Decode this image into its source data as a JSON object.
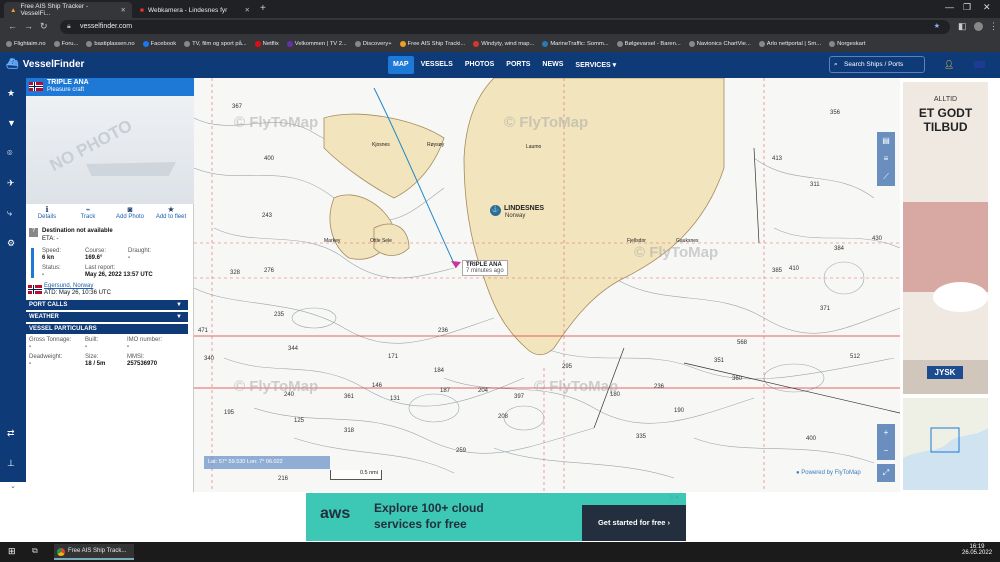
{
  "browser": {
    "tabs": [
      {
        "title": "Free AIS Ship Tracker - VesselFi...",
        "active": true
      },
      {
        "title": "Webkamera - Lindesnes fyr",
        "active": false
      }
    ],
    "url": "vesselfinder.com",
    "bookmarks": [
      "Flightaim.no",
      "Foru...",
      "bastiplassen.no",
      "Facebook",
      "TV, film og sport på...",
      "Netflix",
      "Velkommen | TV 2...",
      "Discovery+",
      "Free AIS Ship Tracki...",
      "Windyty, wind map...",
      "MarineTraffic: Somm...",
      "Bølgevarsel - Baren...",
      "Navionics ChartVie...",
      "Arlo nettportal | Sm...",
      "Norgeskart"
    ]
  },
  "header": {
    "logo": "VesselFinder",
    "menu": [
      {
        "label": "MAP",
        "active": true
      },
      {
        "label": "VESSELS",
        "active": false
      },
      {
        "label": "PHOTOS",
        "active": false
      },
      {
        "label": "PORTS",
        "active": false
      },
      {
        "label": "NEWS",
        "active": false
      },
      {
        "label": "SERVICES ▾",
        "active": false
      }
    ],
    "search_placeholder": "Search Ships / Ports"
  },
  "vessel": {
    "name": "TRIPLE ANA",
    "type": "Pleasure craft",
    "no_photo": "NO PHOTO",
    "actions": [
      "Details",
      "Track",
      "Add Photo",
      "Add to fleet"
    ],
    "destination": "Destination not available",
    "eta": "ETA: -",
    "speed_label": "Speed:",
    "speed": "6 kn",
    "course_label": "Course:",
    "course": "169.6°",
    "draught_label": "Draught:",
    "draught": "-",
    "status_label": "Status:",
    "status": "-",
    "last_report_label": "Last report:",
    "last_report": "May 26, 2022 13:57 UTC",
    "origin": "Egersund, Norway",
    "atd": "ATD: May 26, 10:36 UTC",
    "sections": [
      "PORT CALLS",
      "WEATHER",
      "VESSEL PARTICULARS"
    ],
    "gt_label": "Gross Tonnage:",
    "gt": "-",
    "built_label": "Built:",
    "built": "-",
    "imo_label": "IMO number:",
    "imo": "-",
    "dw_label": "Deadweight:",
    "dw": "-",
    "size_label": "Size:",
    "size": "18 / 5m",
    "mmsi_label": "MMSI:",
    "mmsi": "257536970"
  },
  "map": {
    "watermark": "© FlyToMap",
    "labels": {
      "lindesnes": "LINDESNES",
      "norway": "Norway",
      "laumo": "Laumo",
      "fjellsdor": "Fjellsdor",
      "gauksnes": "Gauksnes",
      "markey": "Markey",
      "ottle_sele": "Ottle Sele",
      "roysey": "Røysøy",
      "kjosnes": "Kjosnes"
    },
    "tooltip_name": "TRIPLE ANA",
    "tooltip_time": "7 minutes ago",
    "coords": "Lat: 57° 59.530  Lon: 7° 06.022",
    "scale": "0.5 nmi",
    "powered": "● Powered by FlyToMap",
    "depths": [
      "367",
      "400",
      "243",
      "328",
      "471",
      "340",
      "236",
      "171",
      "146",
      "131",
      "195",
      "240",
      "125",
      "259",
      "208",
      "361",
      "397",
      "295",
      "184",
      "235",
      "344",
      "413",
      "430",
      "384",
      "371",
      "512",
      "568",
      "351",
      "360",
      "400",
      "187",
      "204",
      "216",
      "318",
      "335",
      "190",
      "180",
      "236",
      "311",
      "410",
      "356",
      "385",
      "276"
    ]
  },
  "ad": {
    "line1": "ALLTID",
    "line2": "ET GODT",
    "line3": "TILBUD",
    "brand": "JYSK"
  },
  "bottom_ad": {
    "brand": "aws",
    "line1": "Explore 100+ cloud",
    "line2": "services for free",
    "cta": "Get started for free ›"
  },
  "taskbar": {
    "app": "Free AIS Ship Track...",
    "time": "16:19",
    "date": "26.05.2022"
  }
}
